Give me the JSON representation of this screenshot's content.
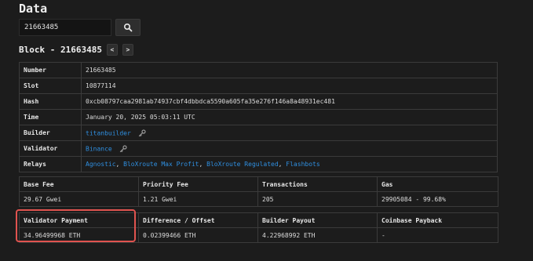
{
  "page": {
    "title": "Data"
  },
  "search": {
    "value": "21663485",
    "button_icon": "search-icon"
  },
  "block": {
    "heading": "Block - 21663485",
    "prev_label": "<",
    "next_label": ">"
  },
  "details": {
    "number": {
      "label": "Number",
      "value": "21663485"
    },
    "slot": {
      "label": "Slot",
      "value": "10877114"
    },
    "hash": {
      "label": "Hash",
      "value": "0xcb08797caa2981ab74937cbf4dbbdca5590a605fa35e276f146a8a48931ec481"
    },
    "time": {
      "label": "Time",
      "value": "January 20, 2025 05:03:11 UTC"
    },
    "builder": {
      "label": "Builder",
      "value": "titanbuilder",
      "icon": "key-icon"
    },
    "validator": {
      "label": "Validator",
      "value": "Binance",
      "icon": "key-icon"
    },
    "relays": {
      "label": "Relays",
      "items": [
        "Agnostic",
        "BloXroute Max Profit",
        "BloXroute Regulated",
        "Flashbots"
      ],
      "separator": ", "
    }
  },
  "stats": {
    "headers": [
      "Base Fee",
      "Priority Fee",
      "Transactions",
      "Gas"
    ],
    "values": [
      "29.67 Gwei",
      "1.21 Gwei",
      "205",
      "29905084 - 99.68%"
    ]
  },
  "payments": {
    "headers": [
      "Validator Payment",
      "Difference / Offset",
      "Builder Payout",
      "Coinbase Payback"
    ],
    "values": [
      "34.96499968 ETH",
      "0.02399466 ETH",
      "4.22968992 ETH",
      "-"
    ]
  },
  "colors": {
    "link": "#2f8fe0",
    "highlight": "#e0534f",
    "background": "#1c1c1c"
  }
}
